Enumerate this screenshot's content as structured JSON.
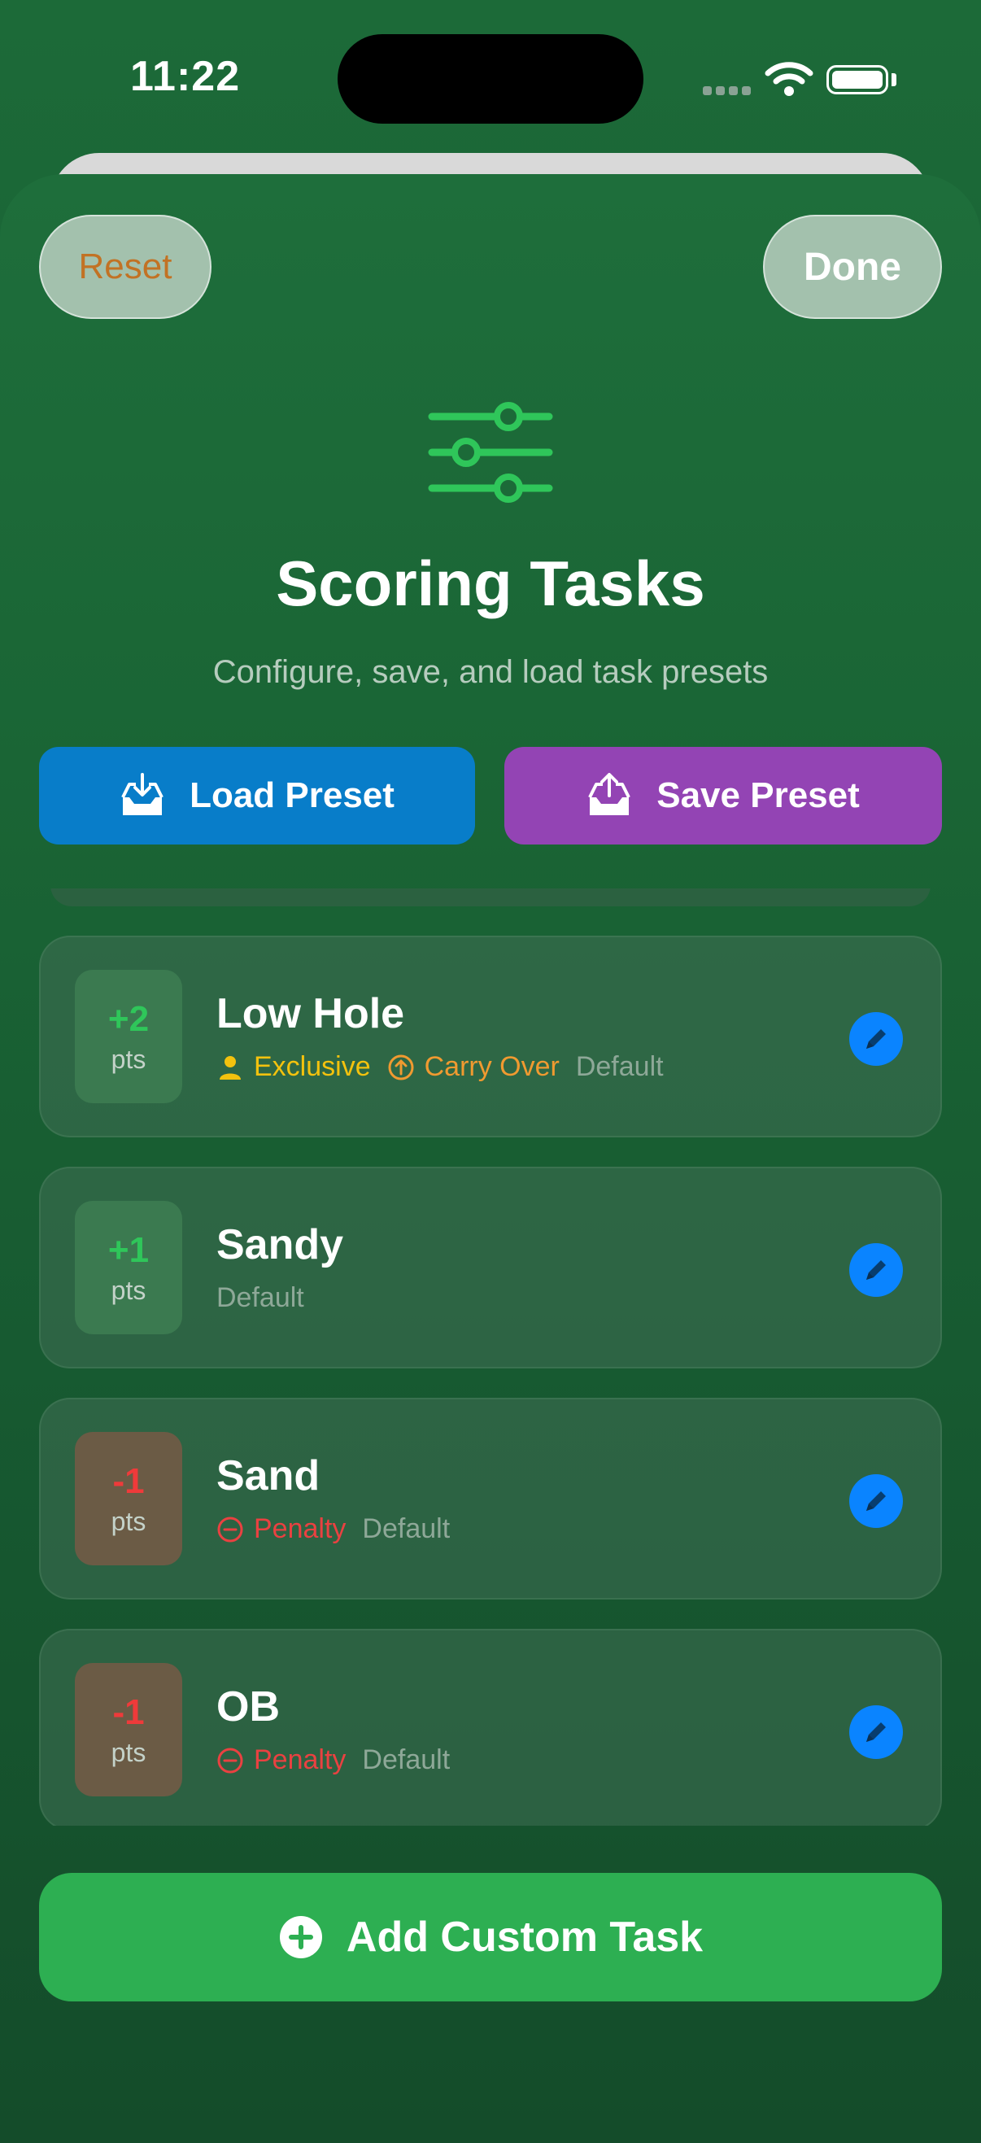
{
  "status_bar": {
    "time": "11:22"
  },
  "toolbar": {
    "reset_label": "Reset",
    "done_label": "Done"
  },
  "header": {
    "icon": "sliders-icon",
    "title": "Scoring Tasks",
    "subtitle": "Configure, save, and load task presets"
  },
  "presets": {
    "load_label": "Load Preset",
    "save_label": "Save Preset"
  },
  "tasks": [
    {
      "points": "+2",
      "unit": "pts",
      "name": "Low Hole",
      "tags": {
        "exclusive": "Exclusive",
        "carry": "Carry Over",
        "default": "Default"
      }
    },
    {
      "points": "+1",
      "unit": "pts",
      "name": "Sandy",
      "tags": {
        "default": "Default"
      }
    },
    {
      "points": "-1",
      "unit": "pts",
      "name": "Sand",
      "tags": {
        "penalty": "Penalty",
        "default": "Default"
      }
    },
    {
      "points": "-1",
      "unit": "pts",
      "name": "OB",
      "tags": {
        "penalty": "Penalty",
        "default": "Default"
      }
    }
  ],
  "footer": {
    "add_label": "Add Custom Task"
  },
  "colors": {
    "accent_green": "#2daf52",
    "load_blue": "#087dc9",
    "save_purple": "#9344b4",
    "positive": "#2fc65a",
    "negative": "#ef3a3a",
    "exclusive": "#f3c20e",
    "carry_over": "#f09a30",
    "edit_blue": "#0a84ff"
  }
}
